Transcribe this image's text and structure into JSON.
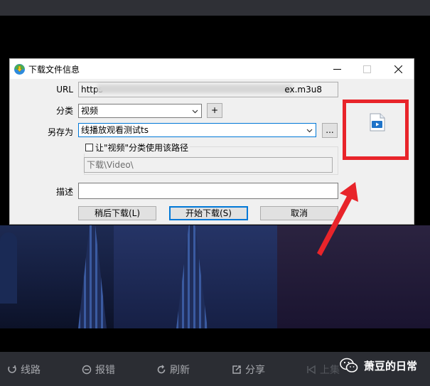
{
  "dialog": {
    "title": "下载文件信息",
    "url": {
      "label": "URL",
      "prefix": "https",
      "suffix": "ex.m3u8"
    },
    "category": {
      "label": "分类",
      "value": "视频",
      "add_button": "+"
    },
    "save_as": {
      "label": "另存为",
      "value": "线播放观看测试ts",
      "browse_button": "..."
    },
    "use_path": {
      "checkbox_label": "让\"视频\"分类使用该路径",
      "path_value": "下载\\Video\\"
    },
    "description": {
      "label": "描述",
      "value": ""
    },
    "buttons": {
      "later": "稍后下载(L)",
      "start": "开始下载(S)",
      "cancel": "取消"
    }
  },
  "player_controls": {
    "route": "线路",
    "report": "报错",
    "refresh": "刷新",
    "share": "分享",
    "prev": "上集"
  },
  "watermark": {
    "text": "萧豆的日常"
  },
  "colors": {
    "highlight": "#e8242a",
    "focus": "#0078d7",
    "control_text": "#a6a8ad",
    "bar": "#2b2d33"
  }
}
